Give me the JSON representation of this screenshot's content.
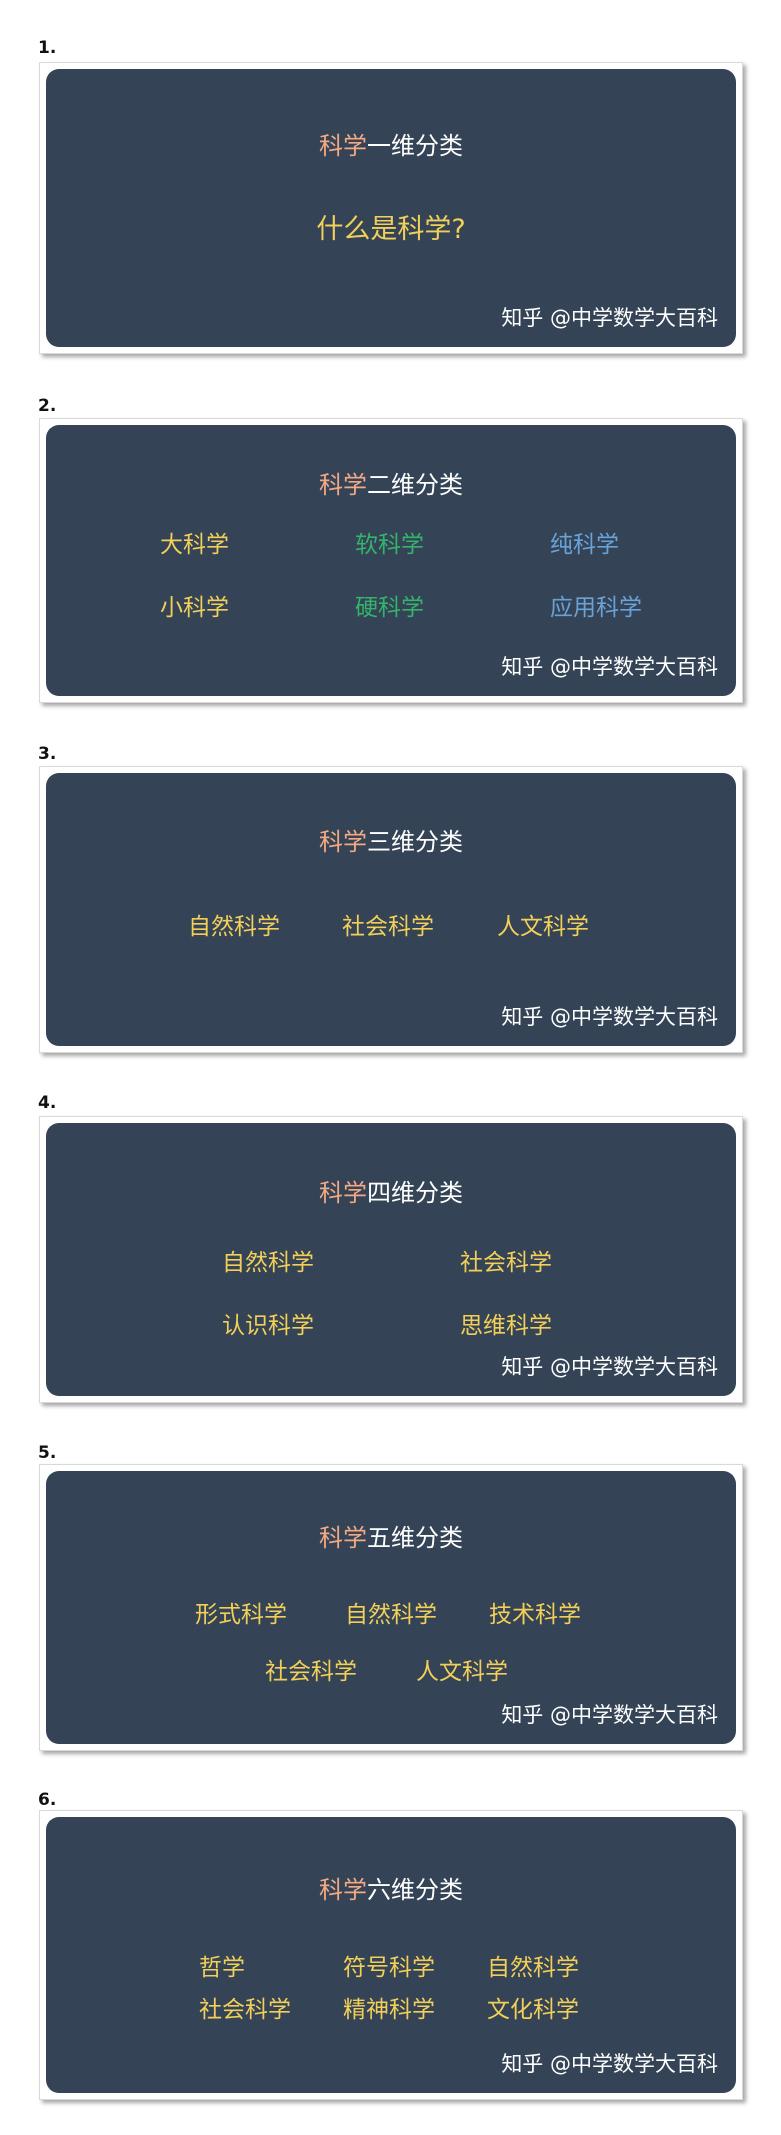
{
  "watermark": "知乎 @中学数学大百科",
  "slides": [
    {
      "number": "1.",
      "title_prefix": "科学",
      "title_suffix": "一维分类",
      "question": "什么是科学?"
    },
    {
      "number": "2.",
      "title_prefix": "科学",
      "title_suffix": "二维分类",
      "items": [
        "大科学",
        "软科学",
        "纯科学",
        "小科学",
        "硬科学",
        "应用科学"
      ]
    },
    {
      "number": "3.",
      "title_prefix": "科学",
      "title_suffix": "三维分类",
      "items": [
        "自然科学",
        "社会科学",
        "人文科学"
      ]
    },
    {
      "number": "4.",
      "title_prefix": "科学",
      "title_suffix": "四维分类",
      "items": [
        "自然科学",
        "社会科学",
        "认识科学",
        "思维科学"
      ]
    },
    {
      "number": "5.",
      "title_prefix": "科学",
      "title_suffix": "五维分类",
      "items": [
        "形式科学",
        "自然科学",
        "技术科学",
        "社会科学",
        "人文科学"
      ]
    },
    {
      "number": "6.",
      "title_prefix": "科学",
      "title_suffix": "六维分类",
      "items": [
        "哲学",
        "符号科学",
        "自然科学",
        "社会科学",
        "精神科学",
        "文化科学"
      ]
    }
  ],
  "colors": {
    "card_background": "#344456",
    "title_accent": "#f2a983",
    "yellow": "#f2cf58",
    "green": "#34b36a",
    "blue": "#6aa2d8"
  }
}
